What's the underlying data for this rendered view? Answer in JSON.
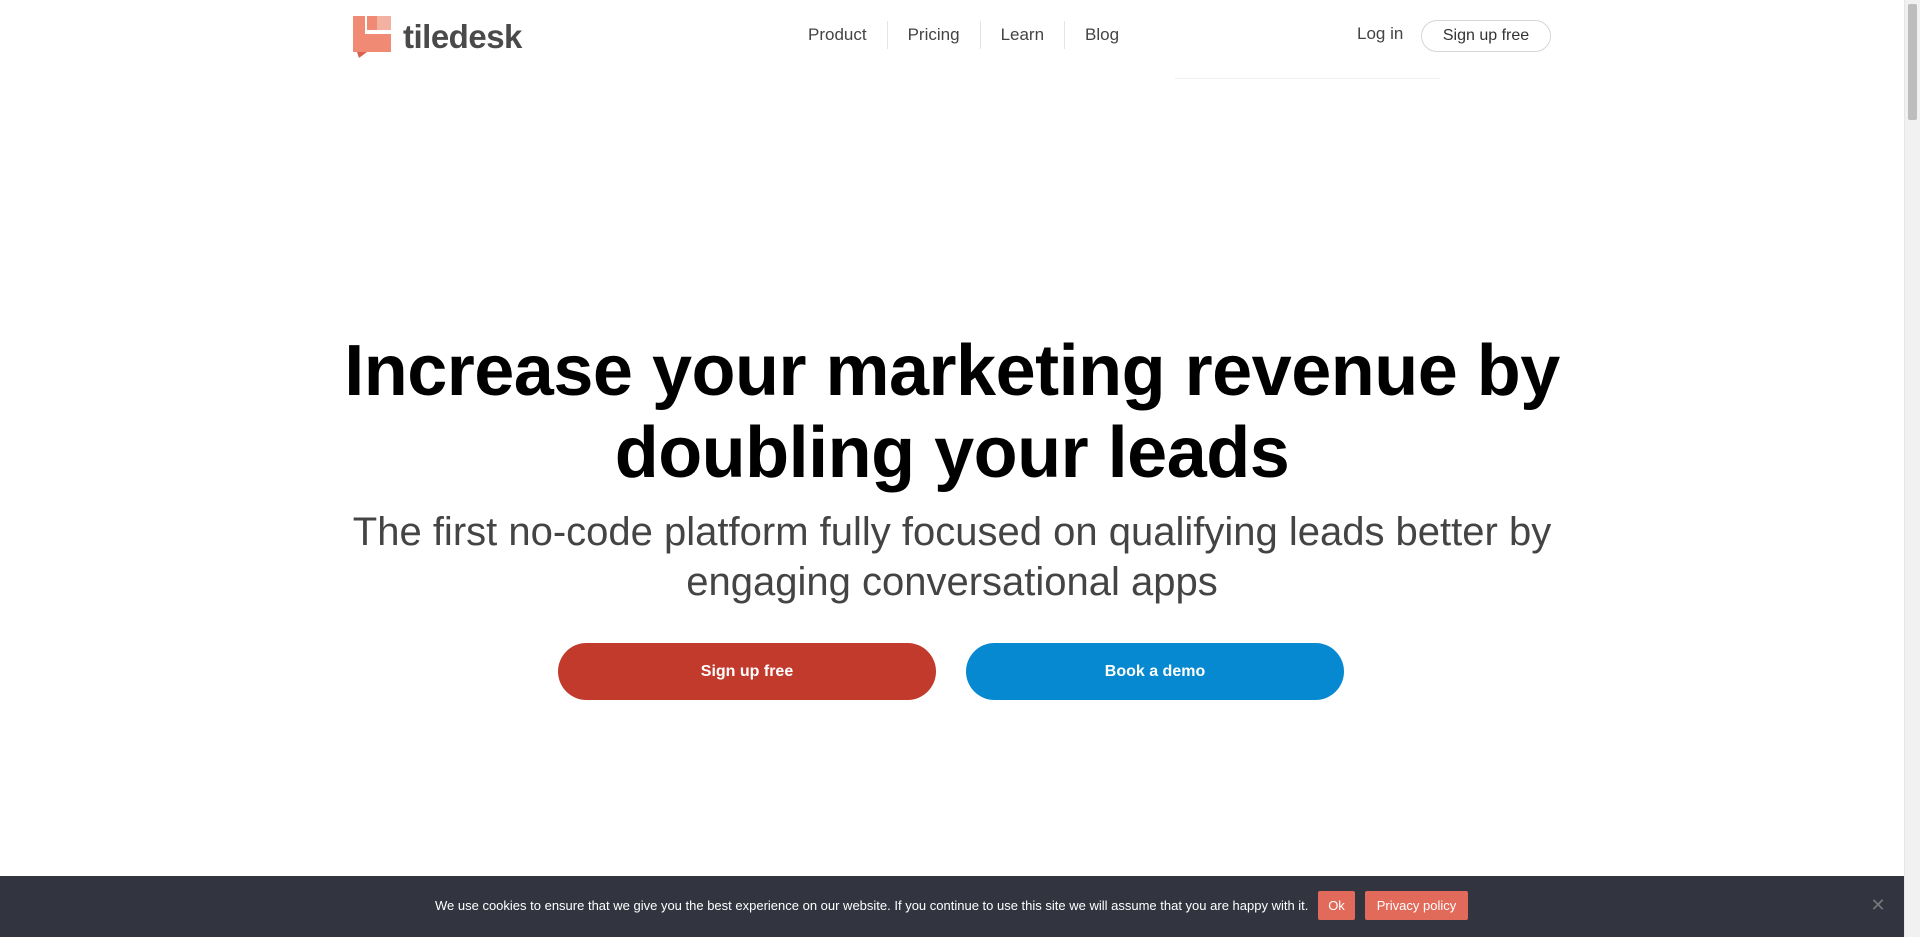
{
  "brand": {
    "name": "tiledesk",
    "colors": {
      "primary": "#f08a74",
      "accent_dark": "#d9624c"
    }
  },
  "nav": {
    "items": [
      {
        "label": "Product"
      },
      {
        "label": "Pricing"
      },
      {
        "label": "Learn"
      },
      {
        "label": "Blog"
      }
    ],
    "login_label": "Log in",
    "signup_label": "Sign up free"
  },
  "hero": {
    "title_line1": "Increase your marketing revenue by",
    "title_line2": "doubling your leads",
    "subtitle_line1": "The first no-code platform fully focused on qualifying leads better by",
    "subtitle_line2": "engaging conversational apps",
    "cta_primary": "Sign up free",
    "cta_secondary": "Book a demo",
    "colors": {
      "cta_primary": "#c23a2b",
      "cta_secondary": "#0689d0"
    }
  },
  "cookie_bar": {
    "message": "We use cookies to ensure that we give you the best experience on our website. If you continue to use this site we will assume that you are happy with it.",
    "ok_label": "Ok",
    "privacy_label": "Privacy policy",
    "close_icon": "close-icon",
    "colors": {
      "background": "#323440",
      "button": "#e26a5a"
    }
  }
}
